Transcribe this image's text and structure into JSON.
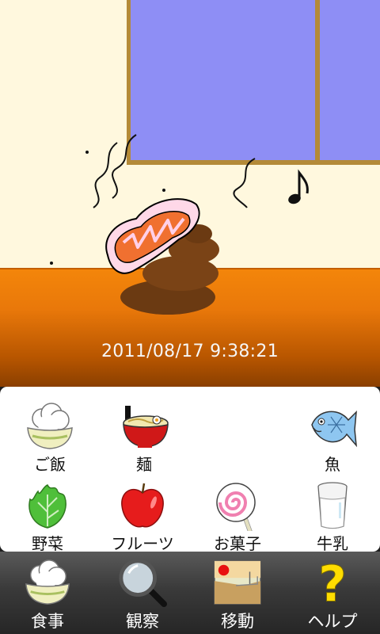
{
  "scene": {
    "timestamp": "2011/08/17 9:38:21",
    "status_icon": "music-note-icon"
  },
  "food_menu": {
    "items": [
      {
        "label": "ご飯",
        "icon": "rice-bowl-icon"
      },
      {
        "label": "麺",
        "icon": "noodle-bowl-icon"
      },
      {
        "label": "魚",
        "icon": "fish-icon"
      },
      {
        "label": "野菜",
        "icon": "lettuce-icon"
      },
      {
        "label": "フルーツ",
        "icon": "apple-icon"
      },
      {
        "label": "お菓子",
        "icon": "lollipop-icon"
      },
      {
        "label": "牛乳",
        "icon": "milk-glass-icon"
      }
    ]
  },
  "bottom_nav": {
    "items": [
      {
        "label": "食事",
        "icon": "rice-bowl-icon"
      },
      {
        "label": "観察",
        "icon": "magnifier-icon"
      },
      {
        "label": "移動",
        "icon": "landscape-icon"
      },
      {
        "label": "ヘルプ",
        "icon": "question-mark-icon"
      }
    ]
  },
  "colors": {
    "wall": "#fff8de",
    "window_glass": "#8e8ef5",
    "window_frame": "#b48a38",
    "floor": "#f4860a",
    "bottom_bar": "#3a3a3a"
  }
}
